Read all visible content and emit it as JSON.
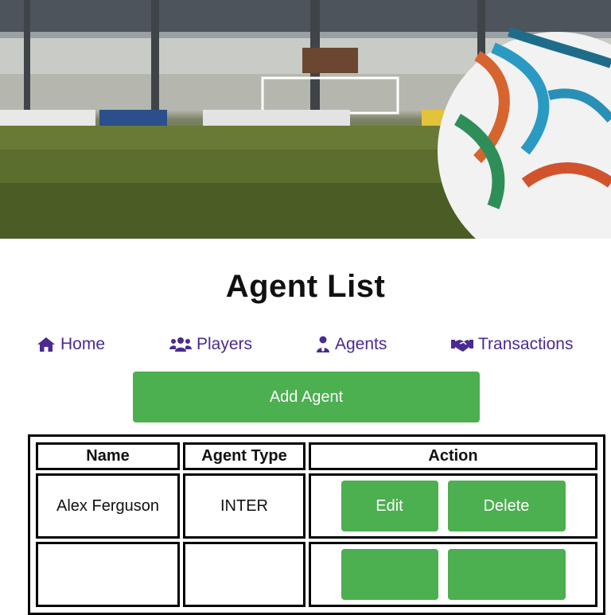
{
  "page": {
    "title": "Agent List"
  },
  "hero": {
    "image": "soccer-stadium-ball"
  },
  "nav": {
    "items": [
      {
        "label": "Home",
        "icon": "home-icon"
      },
      {
        "label": "Players",
        "icon": "users-icon"
      },
      {
        "label": "Agents",
        "icon": "user-tie-icon"
      },
      {
        "label": "Transactions",
        "icon": "handshake-icon"
      }
    ]
  },
  "actions": {
    "add_label": "Add Agent"
  },
  "table": {
    "headers": [
      "Name",
      "Agent Type",
      "Action"
    ],
    "rows": [
      {
        "name": "Alex Ferguson",
        "type": "INTER",
        "edit": "Edit",
        "delete": "Delete"
      },
      {
        "name": "",
        "type": "",
        "edit": "",
        "delete": ""
      }
    ]
  },
  "colors": {
    "accent": "#4caf50",
    "nav_text": "#4b2a91"
  }
}
